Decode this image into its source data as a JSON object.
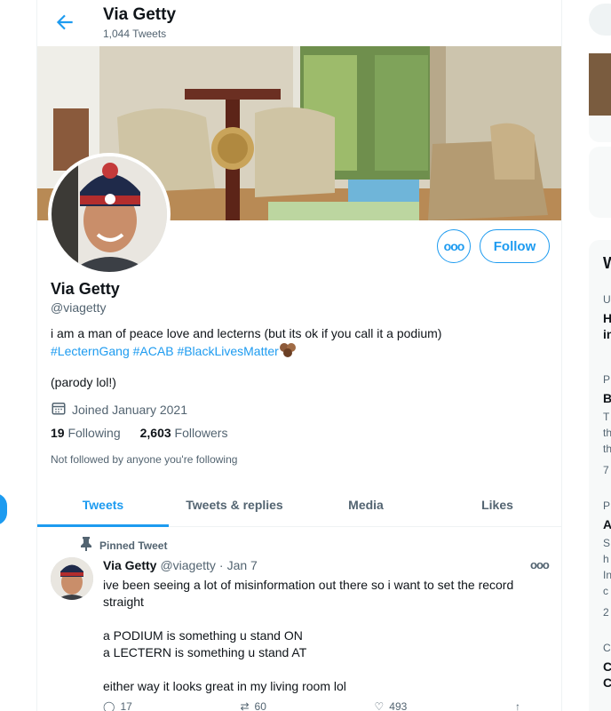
{
  "header": {
    "title": "Via Getty",
    "tweet_count": "1,044 Tweets"
  },
  "profile": {
    "name": "Via Getty",
    "handle": "@viagetty",
    "bio_text": "i am a man of peace love and lecterns (but its ok if you call it a podium)",
    "bio_tags": [
      "#LecternGang",
      "#ACAB",
      "#BlackLivesMatter"
    ],
    "bio_extra": "(parody lol!)",
    "joined": "Joined January 2021",
    "following_count": "19",
    "following_label": "Following",
    "followers_count": "2,603",
    "followers_label": "Followers",
    "not_followed": "Not followed by anyone you're following",
    "follow_label": "Follow",
    "more_label": "ooo"
  },
  "tabs": [
    {
      "label": "Tweets",
      "active": true
    },
    {
      "label": "Tweets & replies",
      "active": false
    },
    {
      "label": "Media",
      "active": false
    },
    {
      "label": "Likes",
      "active": false
    }
  ],
  "tweet": {
    "pinned_label": "Pinned Tweet",
    "name": "Via Getty",
    "handle": "@viagetty",
    "sep": "·",
    "date": "Jan 7",
    "more": "ooo",
    "paragraphs": [
      "ive been seeing a lot of misinformation out there so i want to set the record straight",
      "a PODIUM is something u stand ON\na LECTERN is something u stand AT",
      "either way it looks great in my living room lol"
    ],
    "replies": "17",
    "retweets": "60",
    "likes": "493"
  },
  "right_column": {
    "letters": [
      "U",
      "H",
      "in",
      "P",
      "B",
      "T",
      "th",
      "th",
      "7",
      "P",
      "A",
      "S",
      "h",
      "In",
      "c",
      "2",
      "C",
      "C",
      "C",
      "W"
    ]
  },
  "colors": {
    "accent": "#1d9bf0",
    "text": "#0f1419",
    "muted": "#536471"
  }
}
